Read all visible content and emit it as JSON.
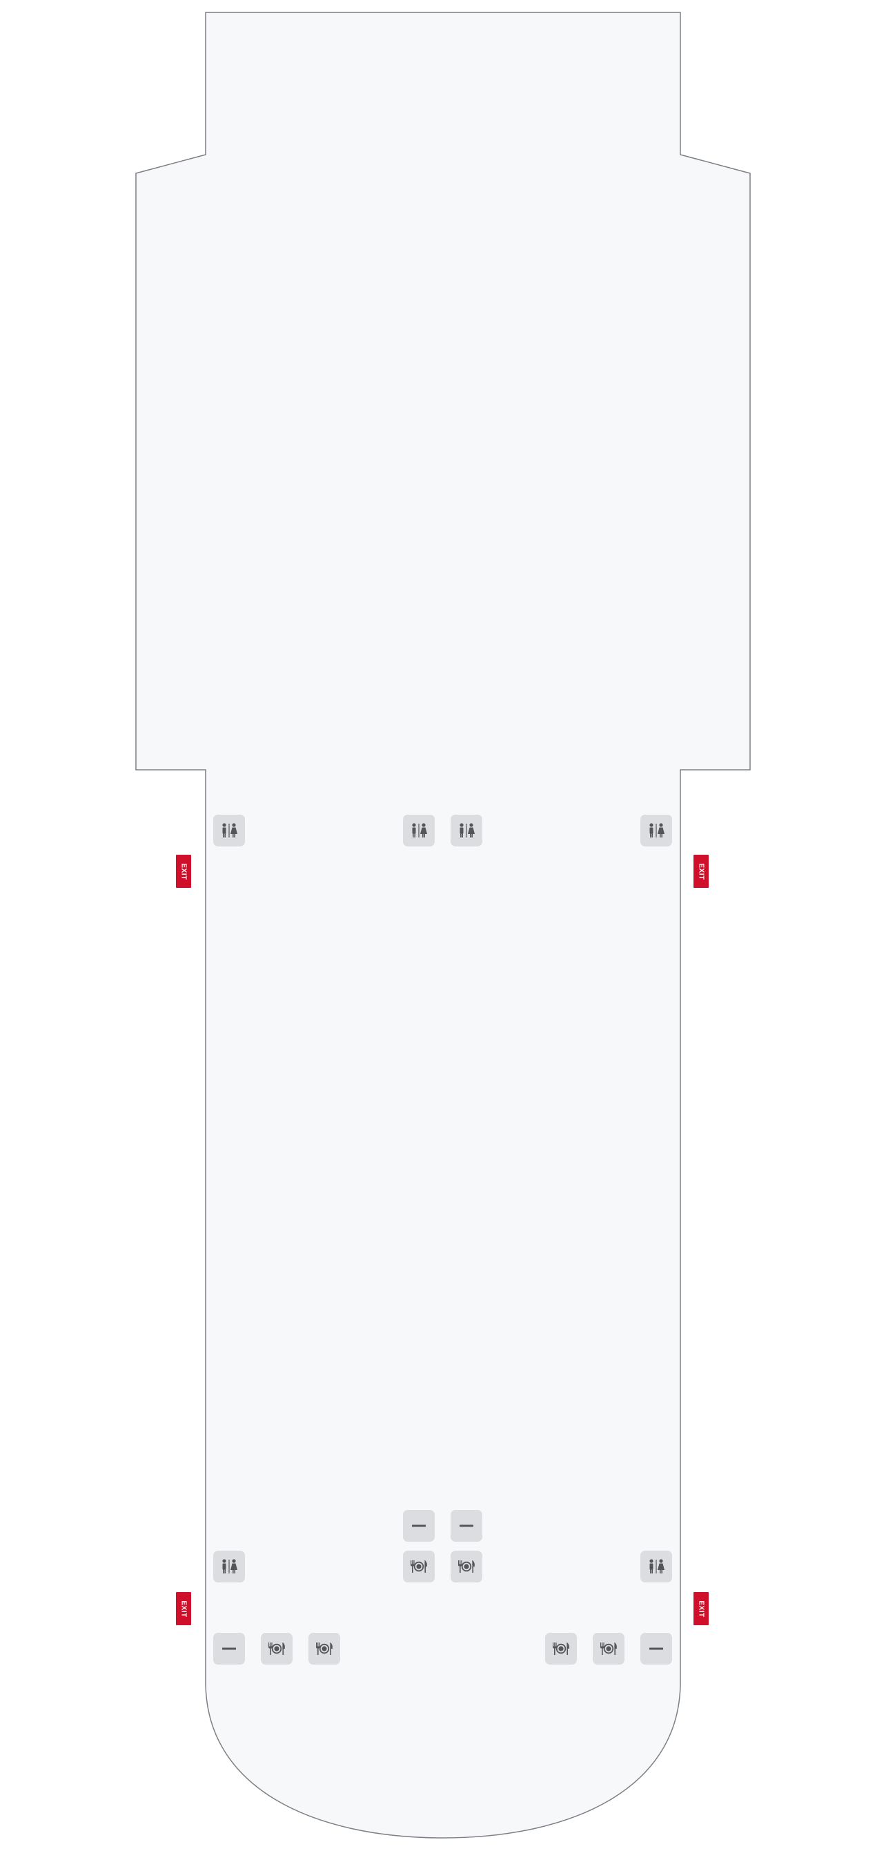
{
  "colors": {
    "cabin_fill": "#f7f8fa",
    "cabin_outline": "#7d7f85",
    "facility_bg": "#dcdde1",
    "icon": "#555558",
    "exit_bg": "#d0102b",
    "exit_text": "#ffffff"
  },
  "seat_map": {
    "exits": [
      {
        "label": "EXIT",
        "side": "left",
        "row_zone": "front"
      },
      {
        "label": "EXIT",
        "side": "right",
        "row_zone": "front"
      },
      {
        "label": "EXIT",
        "side": "left",
        "row_zone": "rear"
      },
      {
        "label": "EXIT",
        "side": "right",
        "row_zone": "rear"
      }
    ],
    "facilities": {
      "front_lavatories": [
        "lavatory-icon",
        "lavatory-icon",
        "lavatory-icon",
        "lavatory-icon"
      ],
      "rear_closets": [
        "closet-icon",
        "closet-icon"
      ],
      "rear_center": [
        "galley-icon",
        "galley-icon"
      ],
      "rear_lavatories": [
        "lavatory-icon",
        "lavatory-icon"
      ],
      "rear_bottom_row": [
        "closet-icon",
        "galley-icon",
        "galley-icon",
        "galley-icon",
        "galley-icon",
        "closet-icon"
      ]
    }
  }
}
